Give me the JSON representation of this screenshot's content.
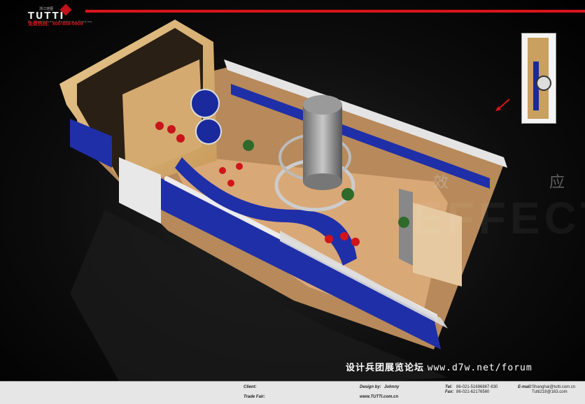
{
  "header": {
    "brand": "TUTTI",
    "brand_cn": "浙江途图",
    "brand_sub": "Z · Exhibition | Building | Display",
    "hotline": "免费热线：800-858-0908",
    "accent_color": "#d8141a"
  },
  "watermark": {
    "cn_1": "效",
    "cn_2": "应",
    "en": "EFFECT"
  },
  "forum": {
    "cn": "设计兵团展览论坛",
    "url": "www.d7w.net/forum"
  },
  "footer": {
    "client_label": "Client:",
    "tradefair_label": "Trade Fair:",
    "design_label": "Design by:",
    "designer": "Johnny",
    "website": "www.TUTTI.com.cn",
    "tel_label": "Tel:",
    "tel": "86-021-51696867-830",
    "fax_label": "Fax:",
    "fax": "86-021-62176560",
    "email_label": "E-mail:",
    "email_1": "Shanghai@tutti.com.cn",
    "email_2": "Tutti218@163.com"
  },
  "icons": [
    "logo-mark",
    "direction-arrow-icon"
  ]
}
